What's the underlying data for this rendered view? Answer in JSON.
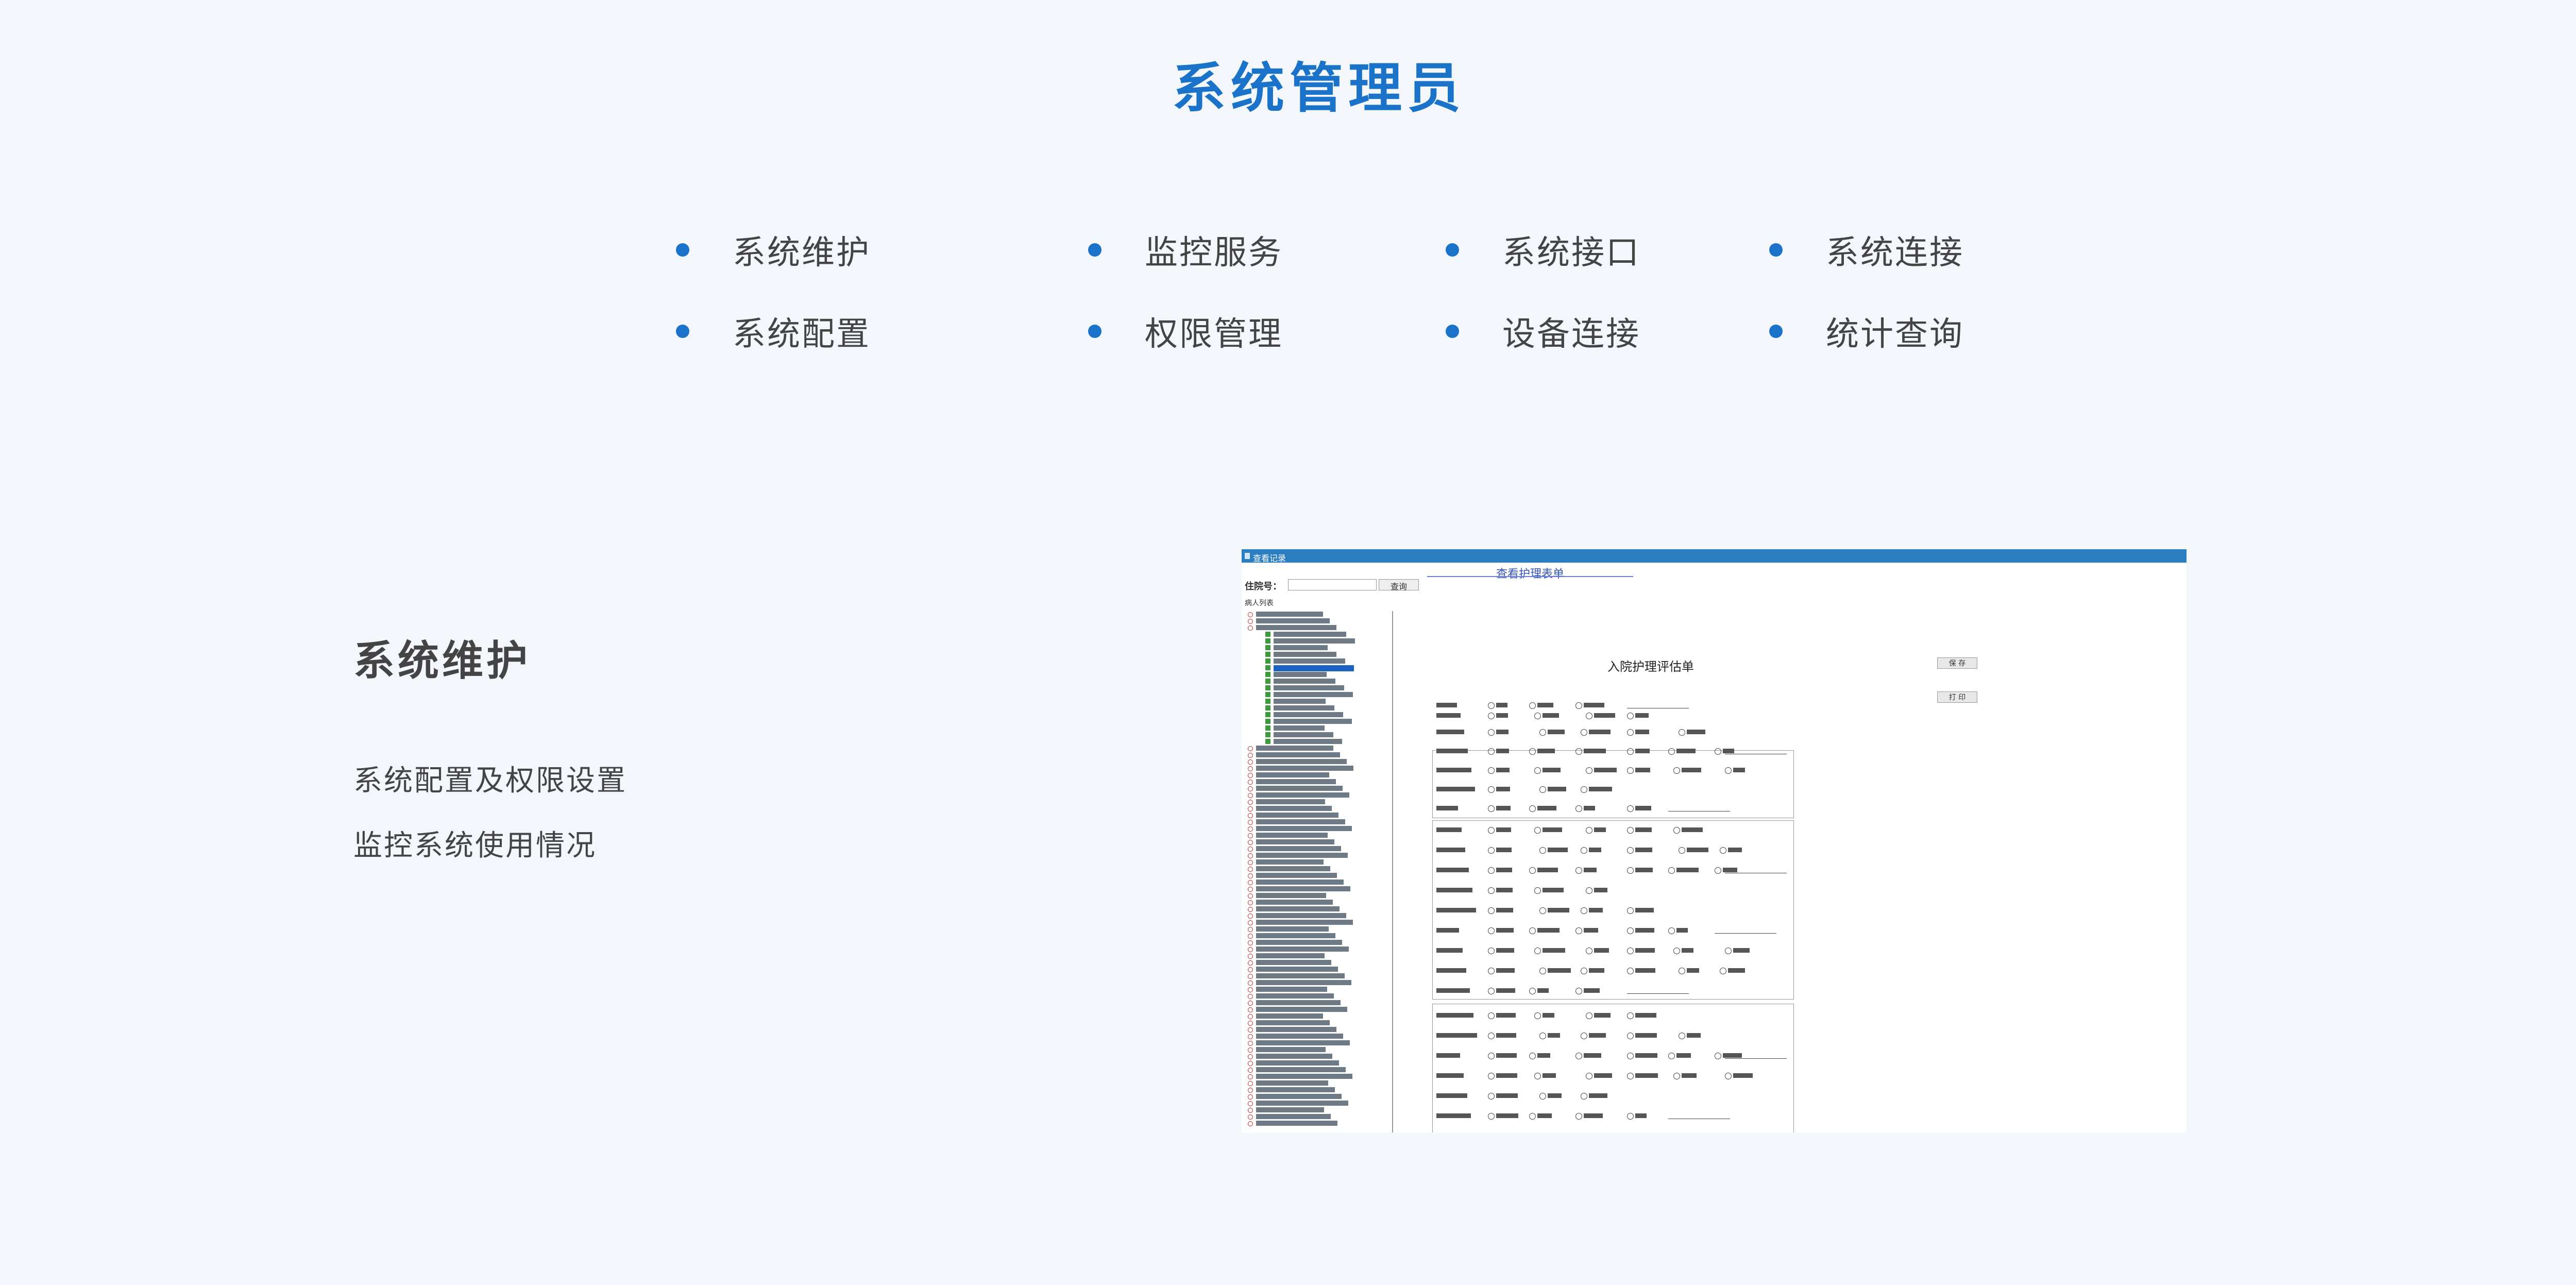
{
  "page": {
    "title": "系统管理员",
    "features": [
      "系统维护",
      "监控服务",
      "系统接口",
      "系统连接",
      "系统配置",
      "权限管理",
      "设备连接",
      "统计查询"
    ],
    "section": {
      "heading": "系统维护",
      "lines": [
        "系统配置及权限设置",
        "监控系统使用情况"
      ]
    }
  },
  "screenshot": {
    "window_title": "查看记录",
    "inpatient_label": "住院号：",
    "query_button": "查询",
    "patient_list_label": "病人列表",
    "tab_title": "查看护理表单",
    "form_title": "入院护理评估单",
    "save_button": "保 存",
    "print_button": "打 印"
  },
  "colors": {
    "accent": "#1a73c8",
    "background": "#f3f7fb",
    "window_bar": "#2a7ec1"
  }
}
